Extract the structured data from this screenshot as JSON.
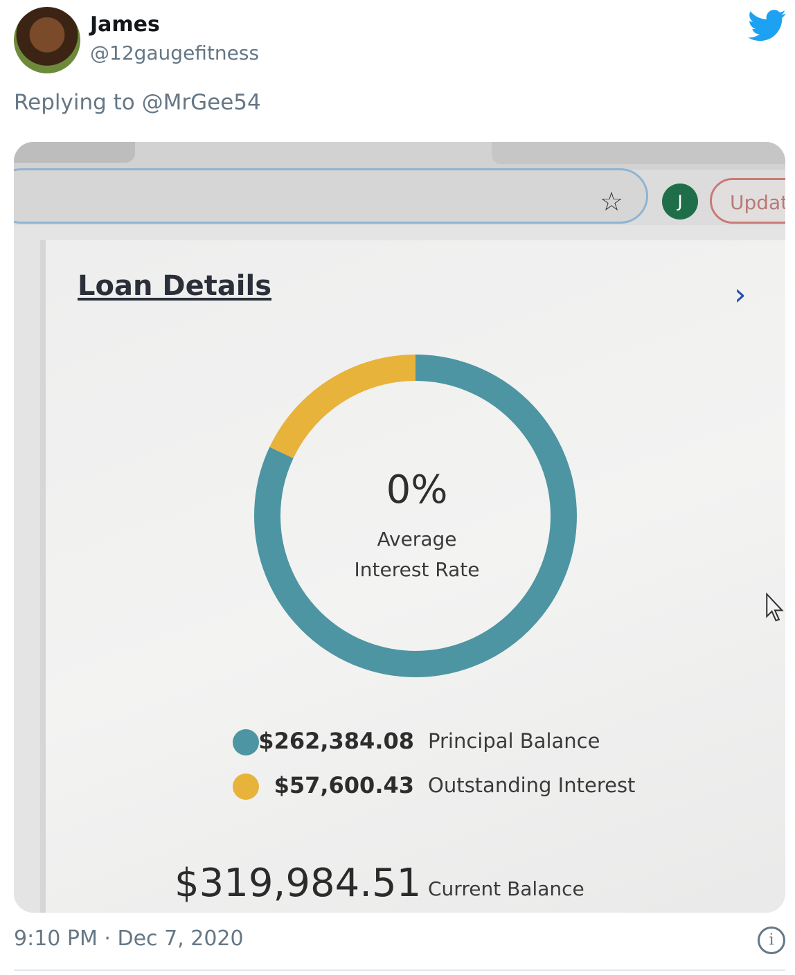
{
  "tweet": {
    "author_name": "James",
    "author_handle": "@12gaugefitness",
    "reply_prefix": "Replying to",
    "reply_to": "@MrGee54",
    "timestamp": "9:10 PM · Dec 7, 2020"
  },
  "browser": {
    "profile_initial": "J",
    "update_label": "Updat",
    "star_glyph": "☆"
  },
  "loan": {
    "title": "Loan Details",
    "rate_value": "0%",
    "rate_label_line1": "Average",
    "rate_label_line2": "Interest Rate",
    "legend": [
      {
        "amount": "$262,384.08",
        "label": "Principal Balance",
        "color": "#4d95a3"
      },
      {
        "amount": "$57,600.43",
        "label": "Outstanding Interest",
        "color": "#e8b33a"
      }
    ],
    "total_amount": "$319,984.51",
    "total_label": "Current Balance"
  },
  "chart_data": {
    "type": "pie",
    "categories": [
      "Principal Balance",
      "Outstanding Interest"
    ],
    "values": [
      262384.08,
      57600.43
    ],
    "colors": [
      "#4d95a3",
      "#e8b33a"
    ]
  },
  "icons": {
    "twitter": "twitter-bird-icon",
    "star": "star-icon",
    "chevron": "chevron-right-icon",
    "info": "info-icon"
  }
}
